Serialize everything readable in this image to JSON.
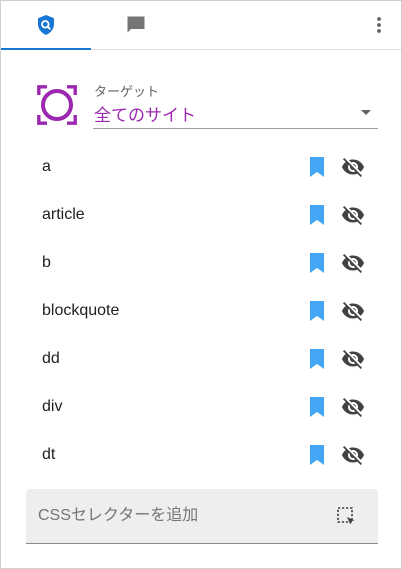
{
  "tabs": [
    {
      "icon": "search-shield-icon",
      "active": true
    },
    {
      "icon": "chat-bubble-icon",
      "active": false
    }
  ],
  "menu_icon": "more-vert-icon",
  "target": {
    "label": "ターゲット",
    "value": "全てのサイト",
    "logo_icon": "all-sites-logo-icon"
  },
  "selectors": [
    {
      "name": "a"
    },
    {
      "name": "article"
    },
    {
      "name": "b"
    },
    {
      "name": "blockquote"
    },
    {
      "name": "dd"
    },
    {
      "name": "div"
    },
    {
      "name": "dt"
    }
  ],
  "add_selector": {
    "placeholder": "CSSセレクターを追加",
    "picker_icon": "element-picker-icon"
  },
  "colors": {
    "accent": "#1976d2",
    "bookmark": "#42a5f5",
    "target_value": "#9c27b0",
    "logo": "#9c27b0"
  }
}
